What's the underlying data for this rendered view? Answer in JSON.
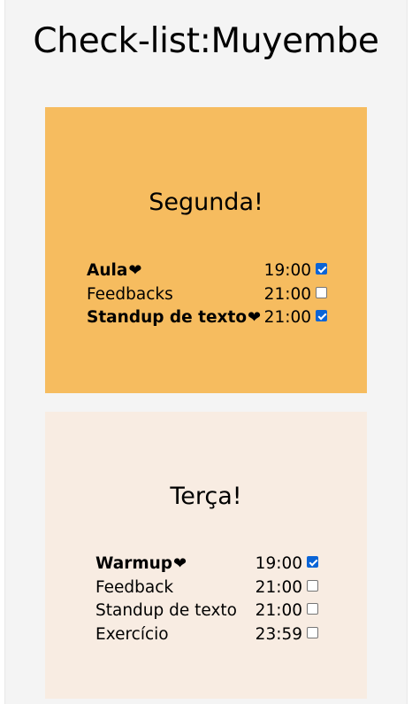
{
  "page": {
    "title": "Check-list:Muyembe"
  },
  "colors": {
    "page_background": "#f4f4f4",
    "monday_card": "#f6bc5f",
    "tuesday_card": "#f8ece2",
    "checkbox_checked": "#0a64d6"
  },
  "days": [
    {
      "heading": "Segunda!",
      "tasks": [
        {
          "name": "Aula",
          "time": "19:00",
          "done": true,
          "heart": "❤"
        },
        {
          "name": "Feedbacks",
          "time": "21:00",
          "done": false,
          "heart": ""
        },
        {
          "name": "Standup de texto",
          "time": "21:00",
          "done": true,
          "heart": "❤"
        }
      ]
    },
    {
      "heading": "Terça!",
      "tasks": [
        {
          "name": "Warmup",
          "time": "19:00",
          "done": true,
          "heart": "❤"
        },
        {
          "name": "Feedback",
          "time": "21:00",
          "done": false,
          "heart": ""
        },
        {
          "name": "Standup de texto",
          "time": "21:00",
          "done": false,
          "heart": ""
        },
        {
          "name": "Exercício",
          "time": "23:59",
          "done": false,
          "heart": ""
        }
      ]
    }
  ]
}
